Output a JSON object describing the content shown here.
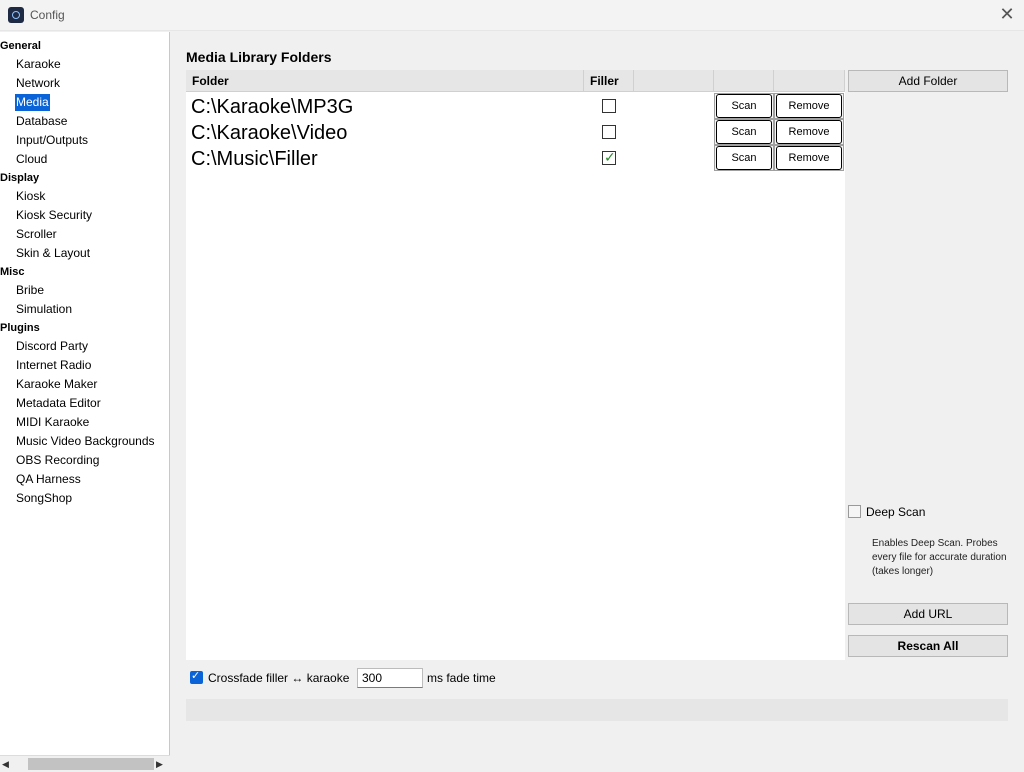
{
  "window": {
    "title": "Config",
    "close_glyph": "✕"
  },
  "nav": {
    "sections": [
      {
        "label": "General",
        "items": [
          "Karaoke",
          "Network",
          "Media",
          "Database",
          "Input/Outputs",
          "Cloud"
        ]
      },
      {
        "label": "Display",
        "items": [
          "Kiosk",
          "Kiosk Security",
          "Scroller",
          "Skin & Layout"
        ]
      },
      {
        "label": "Misc",
        "items": [
          "Bribe",
          "Simulation"
        ]
      },
      {
        "label": "Plugins",
        "items": [
          "Discord Party",
          "Internet Radio",
          "Karaoke Maker",
          "Metadata Editor",
          "MIDI Karaoke",
          "Music Video Backgrounds",
          "OBS Recording",
          "QA Harness",
          "SongShop"
        ]
      }
    ],
    "selected": "Media",
    "scroll_left_glyph": "◀",
    "scroll_right_glyph": "▶"
  },
  "media": {
    "title": "Media Library Folders",
    "columns": {
      "folder": "Folder",
      "filler": "Filler"
    },
    "folders": [
      {
        "path": "C:\\Karaoke\\MP3G",
        "filler": false,
        "scan_label": "Scan",
        "remove_label": "Remove"
      },
      {
        "path": "C:\\Karaoke\\Video",
        "filler": false,
        "scan_label": "Scan",
        "remove_label": "Remove"
      },
      {
        "path": "C:\\Music\\Filler",
        "filler": true,
        "scan_label": "Scan",
        "remove_label": "Remove"
      }
    ],
    "add_folder_label": "Add Folder",
    "deep_scan": {
      "label": "Deep Scan",
      "checked": false,
      "help": "Enables Deep Scan. Probes every file for accurate duration (takes longer)"
    },
    "add_url_label": "Add URL",
    "rescan_all_label": "Rescan All",
    "crossfade": {
      "checked": true,
      "label": "Crossfade filler ↔ karaoke",
      "value": "300",
      "units": "ms fade time"
    }
  },
  "colors": {
    "accent": "#0a64d8",
    "filler_check": "#2d8a2d"
  }
}
